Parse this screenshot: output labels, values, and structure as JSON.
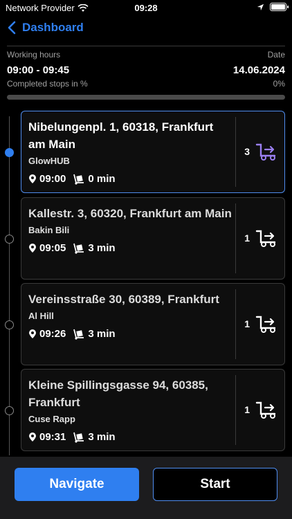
{
  "status": {
    "carrier": "Network Provider",
    "time": "09:28"
  },
  "header": {
    "back_label": "Dashboard"
  },
  "info": {
    "working_hours_label": "Working hours",
    "working_hours_value": "09:00 - 09:45",
    "date_label": "Date",
    "date_value": "14.06.2024",
    "completed_label": "Completed stops in %",
    "completed_value": "0%",
    "completed_fraction": 0
  },
  "stops": [
    {
      "address": "Nibelungenpl. 1, 60318, Frankfurt am Main",
      "name": "GlowHUB",
      "time": "09:00",
      "duration": "0 min",
      "count": "3",
      "active": true
    },
    {
      "address": "Kallestr. 3, 60320, Frankfurt am Main",
      "name": "Bakin Bili",
      "time": "09:05",
      "duration": "3 min",
      "count": "1",
      "active": false
    },
    {
      "address": "Vereinsstraße 30, 60389, Frankfurt",
      "name": "Al Hill",
      "time": "09:26",
      "duration": "3 min",
      "count": "1",
      "active": false
    },
    {
      "address": "Kleine Spillingsgasse 94, 60385, Frankfurt",
      "name": "Cuse Rapp",
      "time": "09:31",
      "duration": "3 min",
      "count": "1",
      "active": false
    }
  ],
  "buttons": {
    "navigate": "Navigate",
    "start": "Start"
  },
  "colors": {
    "accent": "#2f7ff0",
    "truck_active": "#9a7ff0"
  },
  "icons": {
    "back": "chevron-left-icon",
    "pin": "location-pin-icon",
    "unload": "dolly-icon",
    "truck": "delivery-truck-icon"
  }
}
